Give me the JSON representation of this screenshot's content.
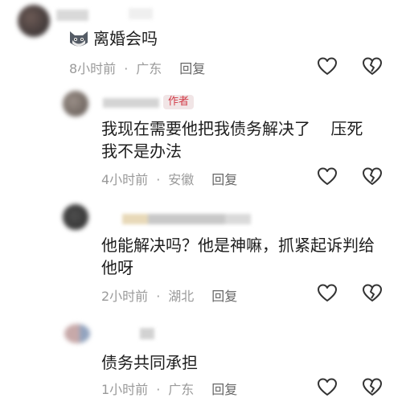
{
  "comments": [
    {
      "text": "离婚会吗",
      "time": "8小时前",
      "location": "广东",
      "reply_label": "回复",
      "emoji": "cat-face-emoji"
    },
    {
      "badge": "作者",
      "text_line1": "我现在需要他把我债务解决了    压死",
      "text_line2": "我不是办法",
      "time": "4小时前",
      "location": "安徽",
      "reply_label": "回复"
    },
    {
      "text_line1": "他能解决吗？他是神嘛，抓紧起诉判给",
      "text_line2": "他呀",
      "time": "2小时前",
      "location": "湖北",
      "reply_label": "回复"
    },
    {
      "text": "债务共同承担",
      "time": "1小时前",
      "location": "广东",
      "reply_label": "回复"
    }
  ],
  "icons": {
    "like": "heart-outline-icon",
    "dislike": "broken-heart-icon"
  },
  "colors": {
    "badge_bg": "#f1e5e6",
    "badge_text": "#d23b47",
    "meta_text": "#9a9a9a",
    "body_text": "#1d1d1d"
  }
}
